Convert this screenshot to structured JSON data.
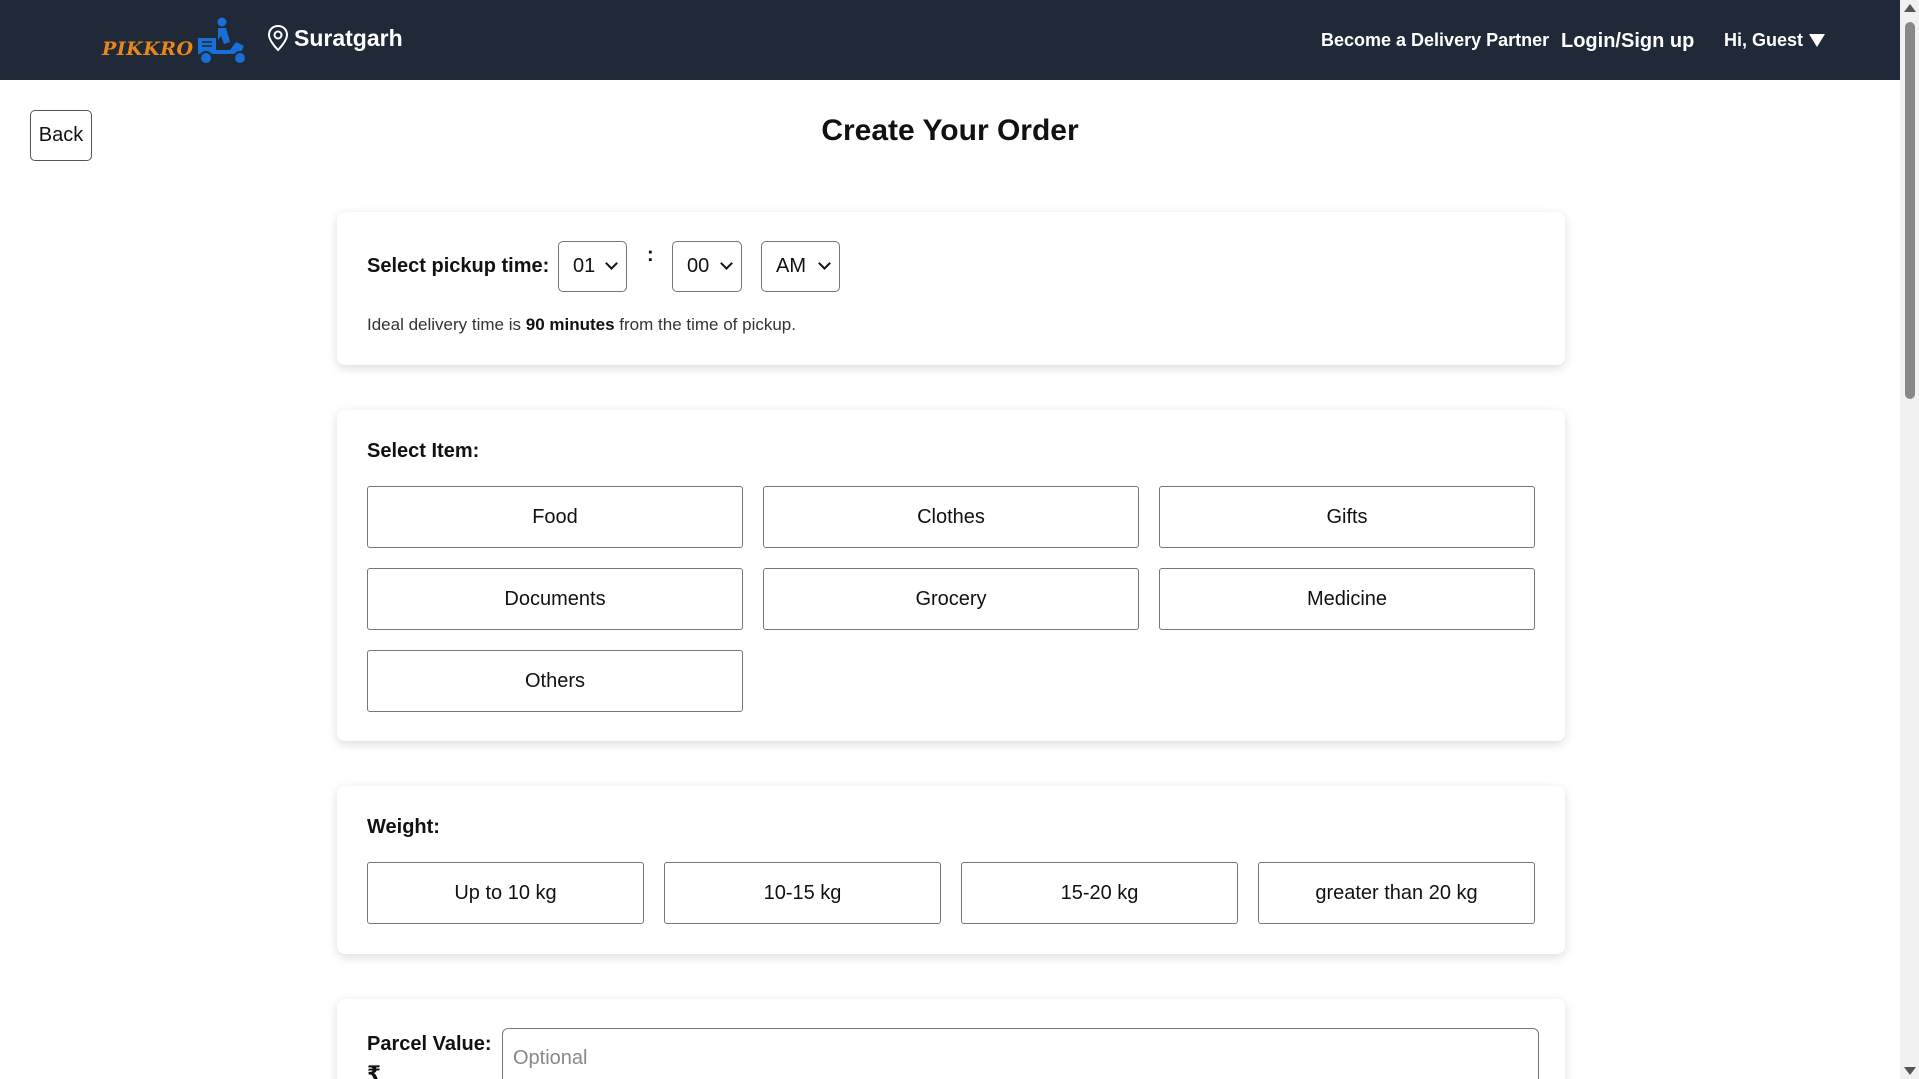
{
  "header": {
    "brand": "PIKKRO",
    "location": "Suratgarh",
    "nav_partner": "Become a Delivery Partner",
    "nav_login": "Login/Sign up",
    "nav_guest": "Hi, Guest"
  },
  "back_label": "Back",
  "page_title": "Create Your Order",
  "pickup": {
    "label": "Select pickup time:",
    "hour": "01",
    "colon": ":",
    "minute": "00",
    "period": "AM",
    "note_prefix": "Ideal delivery time is",
    "note_bold": "90 minutes",
    "note_suffix": "from the time of pickup."
  },
  "items": {
    "label": "Select Item:",
    "options": [
      "Food",
      "Clothes",
      "Gifts",
      "Documents",
      "Grocery",
      "Medicine",
      "Others"
    ]
  },
  "weight": {
    "label": "Weight:",
    "options": [
      "Up to 10 kg",
      "10-15 kg",
      "15-20 kg",
      "greater than 20 kg"
    ]
  },
  "parcel_value": {
    "label": "Parcel Value:",
    "currency": "₹",
    "placeholder": "Optional"
  },
  "colors": {
    "header_bg": "#1f2937",
    "brand_orange": "#e8871e",
    "brand_blue": "#1a6fd6"
  }
}
